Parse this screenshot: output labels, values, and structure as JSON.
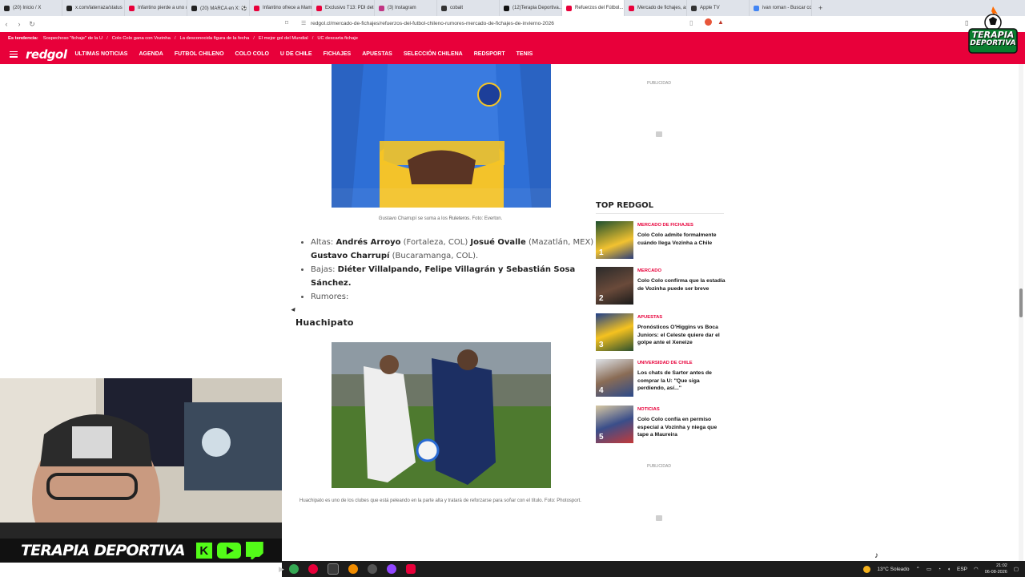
{
  "browser": {
    "tabs": [
      {
        "label": "(20) Inicio / X",
        "color": "#222222"
      },
      {
        "label": "x.com/laterraza/status",
        "color": "#222222"
      },
      {
        "label": "Infantino pierde a uno de...",
        "color": "#e8003a"
      },
      {
        "label": "(20) MARCA en X: ⚽",
        "color": "#222222"
      },
      {
        "label": "Infantino ofrece a Mam...",
        "color": "#e8003a"
      },
      {
        "label": "Exclusivo T13: PDI dete...",
        "color": "#e8003a"
      },
      {
        "label": "(3) Instagram",
        "color": "#c13584"
      },
      {
        "label": "cobalt",
        "color": "#333333"
      },
      {
        "label": "(12)Terapia Deportiva...",
        "color": "#111111"
      },
      {
        "label": "Refuerzos del Fútbol...",
        "color": "#e8003a",
        "active": true
      },
      {
        "label": "Mercado de fichajes, as...",
        "color": "#e8003a"
      },
      {
        "label": "Apple TV",
        "color": "#333333"
      },
      {
        "label": "ivan roman - Buscar co...",
        "color": "#4285f4"
      }
    ],
    "new_tab": "+",
    "url": "redgol.cl/mercado-de-fichajes/refuerzos-del-futbol-chileno-rumores-mercado-de-fichajes-de-invierno-2026"
  },
  "site": {
    "trending_label": "Es tendencia:",
    "trending": [
      "Sospechoso \"fichaje\" de la U",
      "Colo Colo gana con Vozinha",
      "La desconocida figura de la fecha",
      "El mejor gol del Mundial",
      "UC descarta fichaje"
    ],
    "logo": "redgol",
    "nav": [
      "ULTIMAS NOTICIAS",
      "AGENDA",
      "FUTBOL CHILENO",
      "COLO COLO",
      "U DE CHILE",
      "FICHAJES",
      "APUESTAS",
      "SELECCIÓN CHILENA",
      "REDSPORT",
      "TENIS"
    ],
    "badge_line1": "TERAPIA",
    "badge_line2": "DEPORTIVA"
  },
  "article": {
    "caption1_pre": "Gustavo Charrupí se suma a los ",
    "caption1_bold": "Ruleteros",
    "caption1_post": ". Foto: Everton.",
    "altas_label": "Altas:",
    "alta1_name": "Andrés Arroyo",
    "alta1_club": "(Fortaleza, COL)",
    "alta2_name": "Josué Ovalle",
    "alta2_club": "(Mazatlán, MEX) y",
    "alta3_name": "Gustavo Charrupí",
    "alta3_club": "(Bucaramanga, COL).",
    "bajas_label": "Bajas:",
    "bajas_names": "Diéter Villalpando, Felipe Villagrán y Sebastián Sosa Sánchez.",
    "rumores_label": "Rumores:",
    "section_title": "Huachipato",
    "caption2": "Huachipato es uno de los clubes que está peleando en la parte alta y tratará de reforzarse para soñar con el título. Foto: Photosport."
  },
  "sidebar": {
    "publicidad": "PUBLICIDAD",
    "top_title": "TOP REDGOL",
    "items": [
      {
        "rank": "1",
        "category": "MERCADO DE FICHAJES",
        "headline": "Colo Colo admite formalmente cuándo llega Vozinha a Chile"
      },
      {
        "rank": "2",
        "category": "MERCADO",
        "headline": "Colo Colo confirma que la estadía de Vozinha puede ser breve"
      },
      {
        "rank": "3",
        "category": "APUESTAS",
        "headline": "Pronósticos O'Higgins vs Boca Juniors: el Celeste quiere dar el golpe ante el Xeneize"
      },
      {
        "rank": "4",
        "category": "UNIVERSIDAD DE CHILE",
        "headline": "Los chats de Sartor antes de comprar la U: \"Que siga perdiendo, así...\""
      },
      {
        "rank": "5",
        "category": "NOTICIAS",
        "headline": "Colo Colo confía en permiso especial a Vozinha y niega que tape a Maureira"
      }
    ]
  },
  "overlay": {
    "banner_text": "TERAPIA DEPORTIVA",
    "kick_letter": "K"
  },
  "taskbar": {
    "weather": "13°C  Soleado",
    "lang": "ESP",
    "time": "21:02",
    "date": "06-08-2026"
  }
}
